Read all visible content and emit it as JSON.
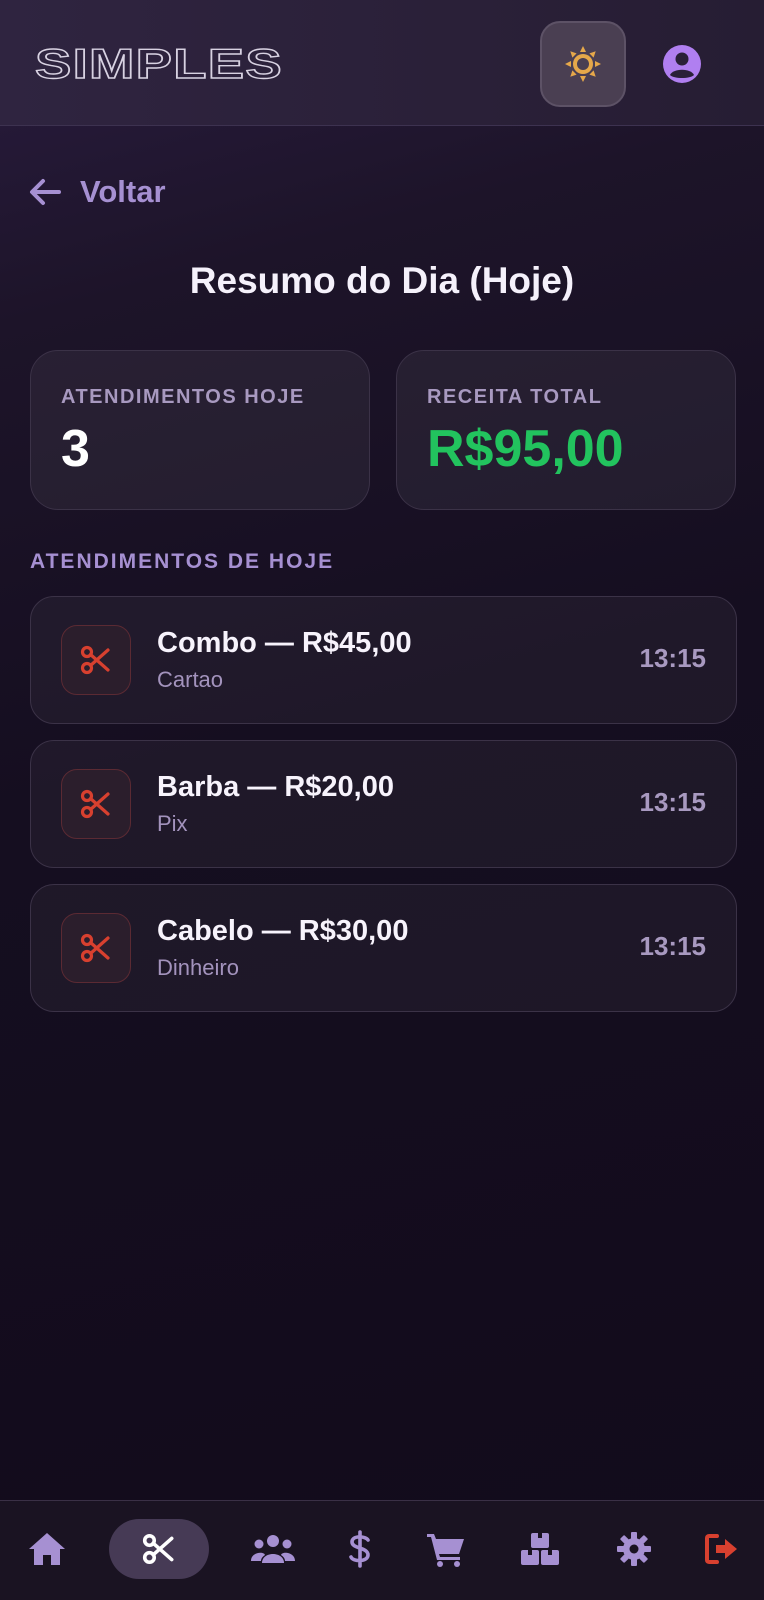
{
  "header": {
    "logo_text": "SIMPLES",
    "theme_icon": "sun-icon",
    "profile_icon": "user-circle-icon"
  },
  "nav_back": {
    "label": "Voltar",
    "icon": "arrow-left-icon"
  },
  "page": {
    "title": "Resumo do Dia (Hoje)"
  },
  "stats": [
    {
      "label": "ATENDIMENTOS HOJE",
      "value": "3"
    },
    {
      "label": "RECEITA TOTAL",
      "value": "R$95,00"
    }
  ],
  "section": {
    "label": "ATENDIMENTOS DE HOJE"
  },
  "appointments": [
    {
      "title": "Combo — R$45,00",
      "payment": "Cartao",
      "time": "13:15",
      "icon": "scissors-icon"
    },
    {
      "title": "Barba — R$20,00",
      "payment": "Pix",
      "time": "13:15",
      "icon": "scissors-icon"
    },
    {
      "title": "Cabelo — R$30,00",
      "payment": "Dinheiro",
      "time": "13:15",
      "icon": "scissors-icon"
    }
  ],
  "bottom_nav": [
    {
      "name": "home",
      "icon": "home-icon"
    },
    {
      "name": "services",
      "icon": "scissors-icon",
      "active": true
    },
    {
      "name": "clients",
      "icon": "users-icon"
    },
    {
      "name": "finance",
      "icon": "dollar-icon"
    },
    {
      "name": "cart",
      "icon": "cart-icon"
    },
    {
      "name": "stock",
      "icon": "boxes-icon"
    },
    {
      "name": "settings",
      "icon": "gear-icon"
    },
    {
      "name": "logout",
      "icon": "logout-icon"
    }
  ],
  "colors": {
    "accent": "#a690d2",
    "money": "#22c35e",
    "danger": "#d8402f",
    "sun": "#e6a84a"
  }
}
